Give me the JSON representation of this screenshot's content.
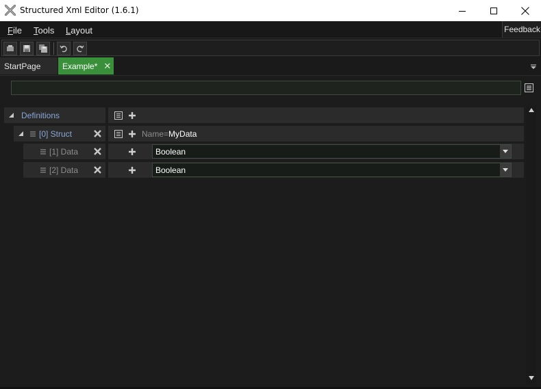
{
  "window": {
    "title": "Structured Xml Editor (1.6.1)",
    "controls": {
      "minimize": "—",
      "maximize": "☐",
      "close": "✕"
    }
  },
  "menu": {
    "file": {
      "accel": "F",
      "rest": "ile"
    },
    "tools": {
      "accel": "T",
      "rest": "ools"
    },
    "layout": {
      "accel": "L",
      "rest": "ayout"
    },
    "feedback": "Feedback"
  },
  "toolbar": {
    "buttons": [
      "new-icon",
      "save-icon",
      "save-as-icon",
      "undo-icon",
      "redo-icon"
    ]
  },
  "tabs": [
    {
      "label": "StartPage",
      "active": false
    },
    {
      "label": "Example*",
      "active": true,
      "close": "✕"
    }
  ],
  "search": {
    "value": "",
    "placeholder": ""
  },
  "tree": {
    "root": {
      "label": "Definitions"
    },
    "struct": {
      "label": "[0] Struct",
      "attr_name": "Name",
      "attr_eq": "=",
      "attr_value": "MyData"
    },
    "items": [
      {
        "label": "[1] Data",
        "value": "Boolean"
      },
      {
        "label": "[2] Data",
        "value": "Boolean"
      }
    ]
  },
  "colors": {
    "accent": "#3a8f3a",
    "background": "#1c1c1c",
    "cell": "#2b2b2b",
    "label_blue": "#8aa7d6"
  }
}
